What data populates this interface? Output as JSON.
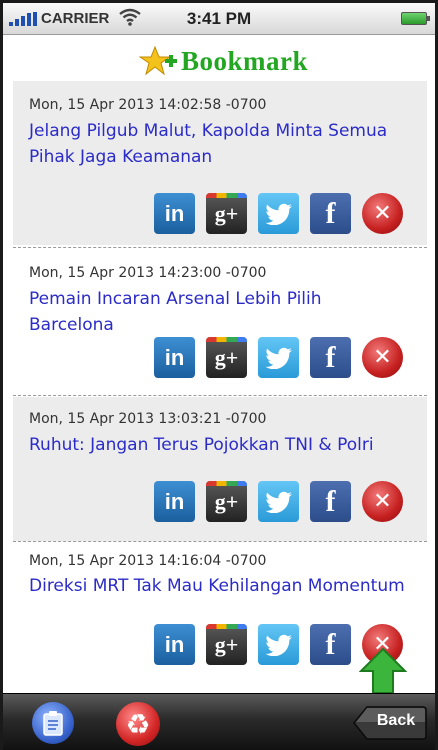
{
  "status_bar": {
    "carrier": "CARRIER",
    "time": "3:41 PM"
  },
  "header": {
    "title": "Bookmark",
    "icon": "star-plus-icon"
  },
  "bookmarks": [
    {
      "date": "Mon, 15 Apr 2013 14:02:58 -0700",
      "headline": "Jelang Pilgub Malut, Kapolda Minta Semua Pihak Jaga Keamanan"
    },
    {
      "date": "Mon, 15 Apr 2013 14:23:00 -0700",
      "headline": "Pemain Incaran Arsenal Lebih Pilih Barcelona"
    },
    {
      "date": "Mon, 15 Apr 2013 13:03:21 -0700",
      "headline": "Ruhut: Jangan Terus Pojokkan TNI & Polri"
    },
    {
      "date": "Mon, 15 Apr 2013 14:16:04 -0700",
      "headline": "Direksi MRT Tak Mau Kehilangan Momentum"
    }
  ],
  "share_icons": [
    "linkedin-icon",
    "google-plus-icon",
    "twitter-icon",
    "facebook-icon",
    "delete-icon"
  ],
  "share_glyphs": {
    "linkedin": "in",
    "google_plus": "g+",
    "facebook": "f",
    "delete": "✕"
  },
  "bottom_bar": {
    "back_label": "Back"
  },
  "colors": {
    "title_green": "#23a723",
    "headline_blue": "#2b2bc8",
    "item_grey": "#ececec"
  }
}
